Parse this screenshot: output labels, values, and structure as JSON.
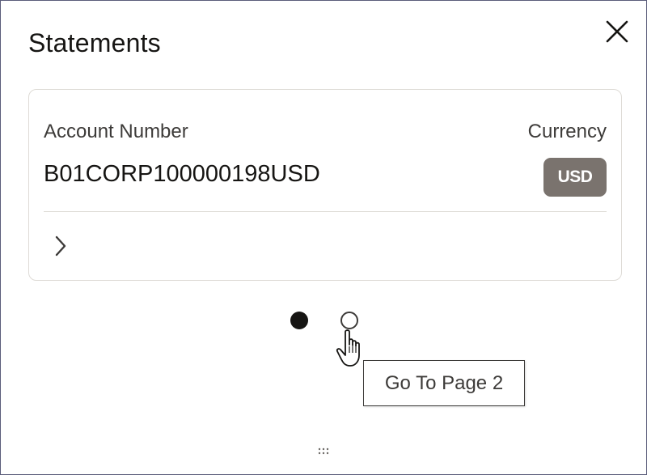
{
  "panel": {
    "title": "Statements"
  },
  "card": {
    "account_label": "Account Number",
    "account_value": "B01CORP100000198USD",
    "currency_label": "Currency",
    "currency_badge": "USD"
  },
  "pagination": {
    "current_page": 1,
    "total_pages": 2,
    "tooltip": "Go To Page 2"
  },
  "icons": {
    "close": "close-icon",
    "expand": "chevron-right-icon",
    "cursor": "hand-pointer-icon",
    "resize": "drag-handle-icon"
  },
  "colors": {
    "badge_bg": "#7a736e",
    "active_dot": "#161513",
    "panel_border": "#5b5d7a"
  }
}
